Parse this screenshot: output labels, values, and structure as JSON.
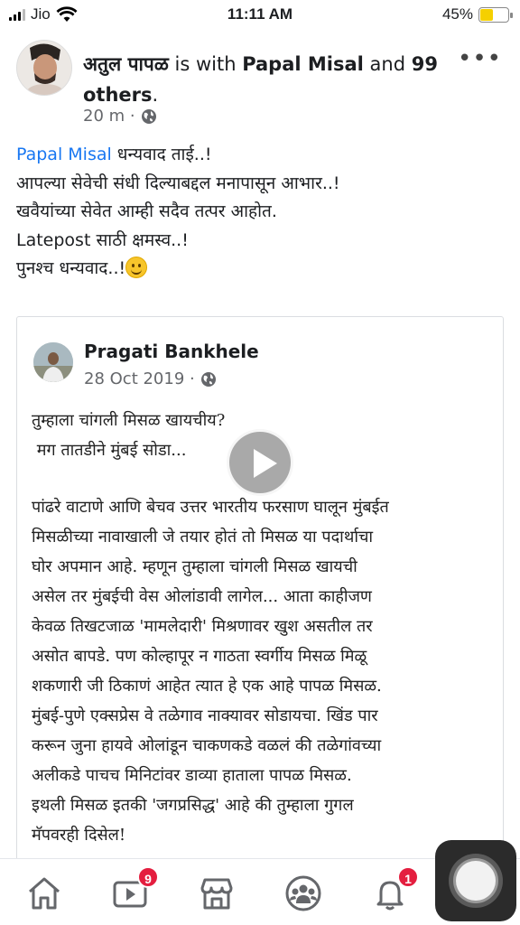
{
  "status_bar": {
    "carrier": "Jio",
    "time": "11:11 AM",
    "battery": "45%",
    "battery_level": 0.45,
    "battery_color": "#f5d000"
  },
  "post": {
    "author": "अतुल पापळ",
    "with_text": " is with ",
    "tagged": "Papal Misal",
    "and_text": " and ",
    "others": "99 others",
    "end_punct": ".",
    "time_ago": "20 m ·",
    "privacy_icon": "globe-icon",
    "body": {
      "mention": "Papal Misal",
      "line1_rest": " धन्यवाद ताई..!",
      "line2": "आपल्या सेवेची संधी दिल्याबद्दल मनापासून आभार..!",
      "line3": "खवैयांच्या सेवेत आम्ही सदैव तत्पर आहोत.",
      "line4": "Latepost साठी क्षमस्व..!",
      "line5": "पुनश्च धन्यवाद..!",
      "emoji": "slightly-smiling-face-icon"
    }
  },
  "shared_post": {
    "author": "Pragati Bankhele",
    "date": "28 Oct 2019 ·",
    "lines_intro": [
      "तुम्हाला चांगली मिसळ खायचीय?",
      " मग तातडीने मुंबई सोडा..."
    ],
    "lines_body": [
      "पांढरे वाटाणे आणि बेचव उत्तर भारतीय फरसाण घालून मुंबईत",
      "मिसळीच्या नावाखाली जे तयार होतं तो मिसळ या पदार्थाचा",
      "घोर अपमान आहे. म्हणून तुम्हाला चांगली मिसळ खायची",
      "असेल तर मुंबईची वेस ओलांडावी लागेल... आता काहीजण",
      "केवळ तिखटजाळ 'मामलेदारी' मिश्रणावर खुश असतील तर",
      "असोत बापडे. पण कोल्हापूर न गाठता स्वर्गीय मिसळ मिळू",
      "शकणारी जी ठिकाणं आहेत त्यात हे एक आहे पापळ मिसळ.",
      "मुंबई-पुणे एक्सप्रेस वे तळेगाव नाक्यावर सोडायचा. खिंड पार",
      "करून जुना हायवे ओलांडून चाकणकडे वळलं की तळेगांवच्या",
      "अलीकडे पाचच मिनिटांवर डाव्या हाताला पापळ मिसळ.",
      "इथली मिसळ इतकी 'जगप्रसिद्ध' आहे की तुम्हाला गुगल",
      "मॅपवरही दिसेल!"
    ]
  },
  "bottom_nav": {
    "items": [
      {
        "icon": "home-icon"
      },
      {
        "icon": "video-icon",
        "badge": "9"
      },
      {
        "icon": "marketplace-icon"
      },
      {
        "icon": "groups-icon"
      },
      {
        "icon": "bell-icon",
        "badge": "1"
      }
    ],
    "badge_color": "#e41e3f"
  },
  "colors": {
    "link": "#1877f2",
    "meta": "#65676b",
    "text": "#1c1e21"
  }
}
